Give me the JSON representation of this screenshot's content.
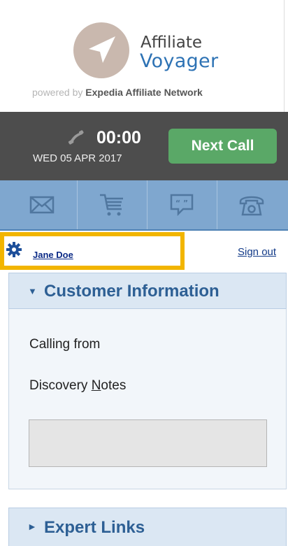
{
  "brand": {
    "line1": "Affiliate",
    "line2": "Voyager",
    "powered_prefix": "powered by",
    "powered_name": "Expedia Affiliate Network",
    "circle_color": "#c9b8ae",
    "accent_color": "#2d72b4"
  },
  "call": {
    "timer": "00:00",
    "date": "WED 05 APR 2017",
    "next_call_label": "Next Call",
    "button_color": "#5aa867"
  },
  "tabs": [
    {
      "icon": "mail-icon"
    },
    {
      "icon": "cart-icon"
    },
    {
      "icon": "chat-icon"
    },
    {
      "icon": "phone-icon"
    }
  ],
  "user": {
    "name": "Jane Doe",
    "sign_out": "Sign out",
    "highlight_color": "#f2b500"
  },
  "customer_info": {
    "title": "Customer Information",
    "calling_from": "Calling from",
    "discovery_notes_pre": "Discovery ",
    "discovery_notes_u": "N",
    "discovery_notes_post": "otes",
    "notes_value": ""
  },
  "expert_links": {
    "title": "Expert Links"
  }
}
